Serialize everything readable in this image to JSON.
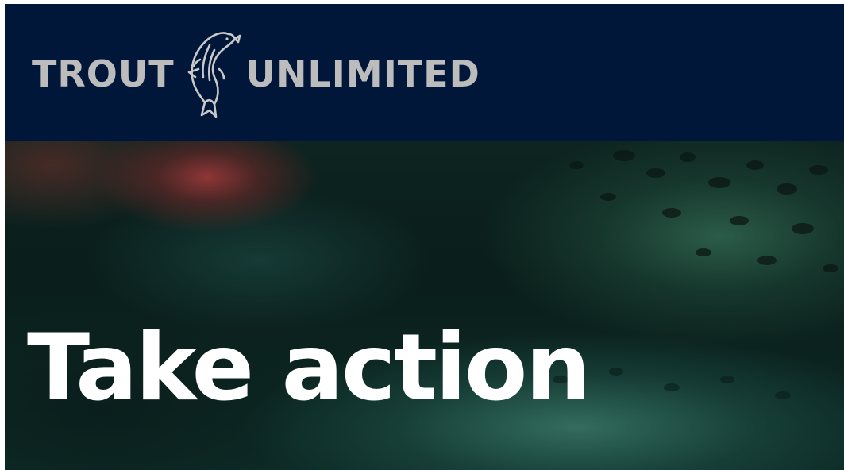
{
  "header": {
    "logo": {
      "word_left": "TROUT",
      "word_right": "UNLIMITED",
      "mark_icon": "trout-fish-icon"
    }
  },
  "hero": {
    "title": "Take action",
    "background": "blurred-trout-photo"
  },
  "colors": {
    "header_bg": "#01173a",
    "logo_text": "#bcbcbc",
    "title_text": "#ffffff"
  }
}
